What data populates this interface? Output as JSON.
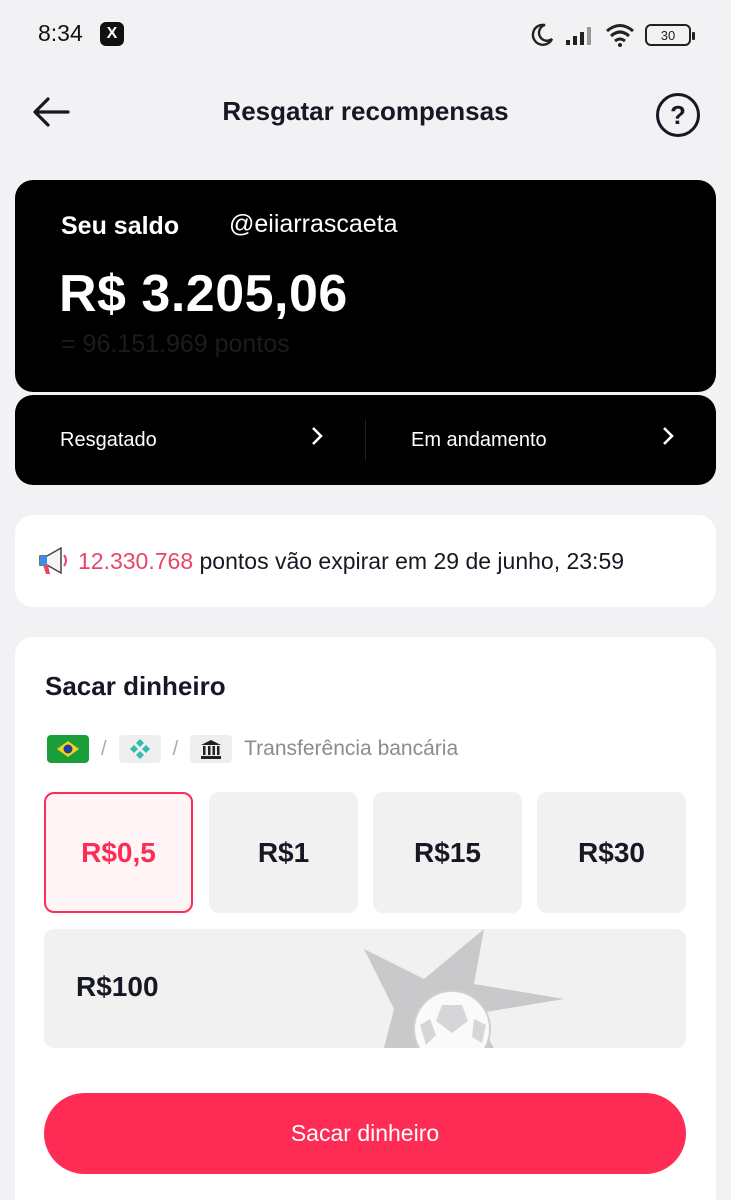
{
  "status_bar": {
    "time": "8:34",
    "app_icon_label": "X",
    "battery": "30"
  },
  "header": {
    "title": "Resgatar recompensas",
    "help_label": "?"
  },
  "balance": {
    "label": "Seu saldo",
    "username": "@eiiarrascaeta",
    "amount": "R$ 3.205,06",
    "points": "= 96.151.969 pontos"
  },
  "status_links": [
    {
      "label": "Resgatado"
    },
    {
      "label": "Em andamento"
    }
  ],
  "notice": {
    "points": "12.330.768",
    "text": " pontos vão expirar em 29 de junho, 23:59"
  },
  "withdraw": {
    "title": "Sacar dinheiro",
    "method_text": "Transferência bancária",
    "amounts": [
      "R$0,5",
      "R$1",
      "R$15",
      "R$30"
    ],
    "amount_wide": "R$100",
    "selected_index": 0,
    "submit_label": "Sacar dinheiro"
  },
  "colors": {
    "accent": "#fe2c55",
    "highlight": "#e8456b",
    "card_dark": "#000000",
    "background": "#f2f2f4"
  }
}
